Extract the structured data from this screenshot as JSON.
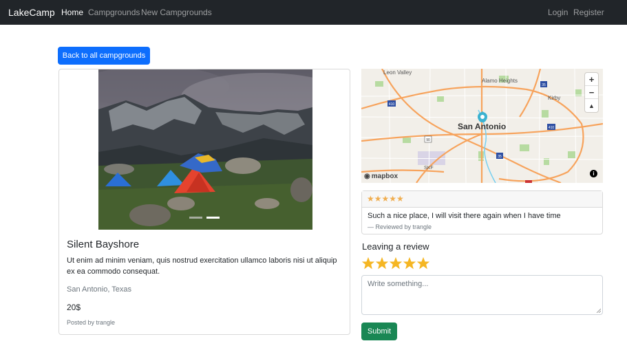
{
  "navbar": {
    "brand": "LakeCamp",
    "links": [
      "Home",
      "Campgrounds",
      "New Campgrounds"
    ],
    "right_links": [
      "Login",
      "Register"
    ]
  },
  "back_button": "Back to all campgrounds",
  "campground": {
    "title": "Silent Bayshore",
    "description": "Ut enim ad minim veniam, quis nostrud exercitation ullamco laboris nisi ut aliquip ex ea commodo consequat.",
    "location": "San Antonio, Texas",
    "price": "20$",
    "posted_by": "Posted by trangle",
    "carousel_active_index": 2,
    "carousel_count": 2
  },
  "map": {
    "city_label": "San Antonio",
    "places": [
      "Leon Valley",
      "Alamo Heights",
      "Kirby",
      "SKF"
    ],
    "route_labels": [
      "410",
      "35",
      "10",
      "90",
      "410",
      "35",
      "10"
    ],
    "zoom_in": "+",
    "zoom_out": "−",
    "compass": "▲",
    "attribution": "mapbox",
    "info": "i"
  },
  "review": {
    "stars": "★★★★★",
    "text": "Such a nice place, I will visit there again when I have time",
    "by": "— Reviewed by trangle"
  },
  "leave_review": {
    "title": "Leaving a review",
    "rating": 5,
    "placeholder": "Write something...",
    "submit": "Submit"
  },
  "colors": {
    "navbar": "#212529",
    "primary": "#0d6efd",
    "success": "#198754",
    "star": "#f5b623"
  }
}
